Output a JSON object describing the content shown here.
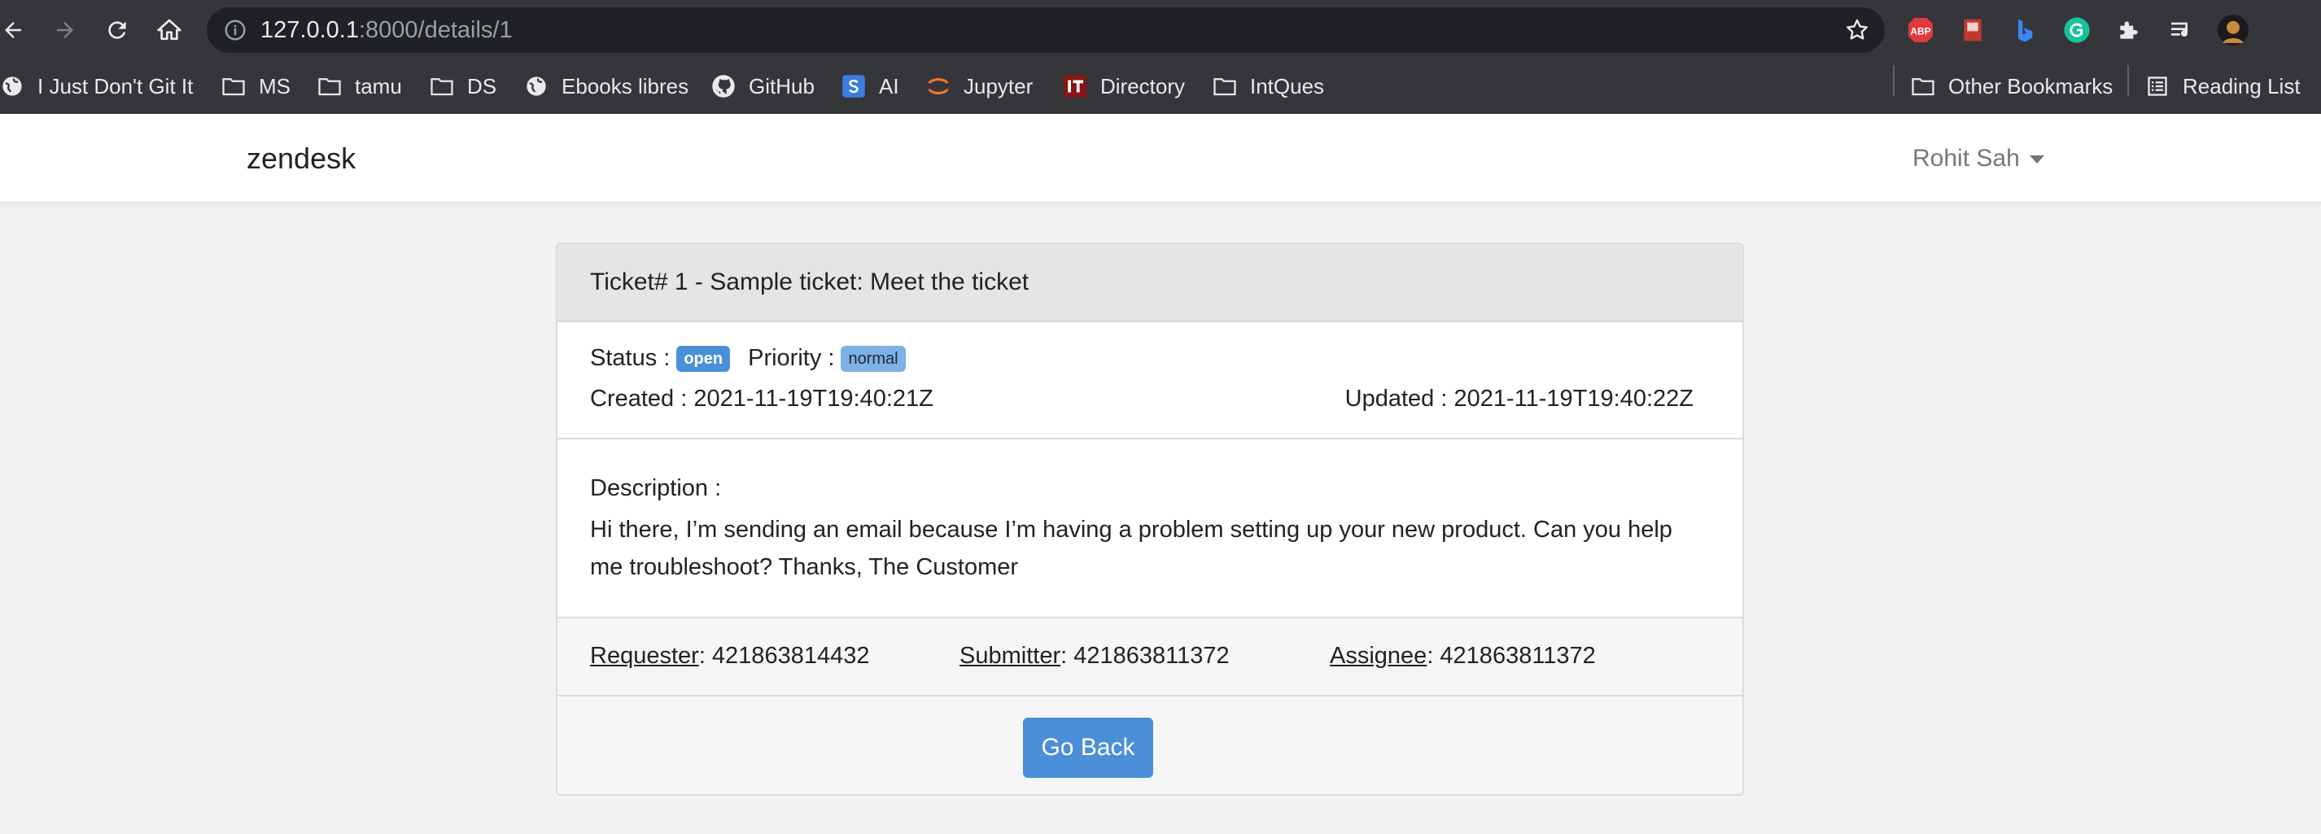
{
  "browser": {
    "url_host": "127.0.0.1",
    "url_path": ":8000/details/1",
    "bookmarks": [
      {
        "label": "I Just Don't Git It",
        "icon": "globe-icon"
      },
      {
        "label": "MS",
        "icon": "folder-icon"
      },
      {
        "label": "tamu",
        "icon": "folder-icon"
      },
      {
        "label": "DS",
        "icon": "folder-icon"
      },
      {
        "label": "Ebooks libres",
        "icon": "globe-icon"
      },
      {
        "label": "GitHub",
        "icon": "github-icon"
      },
      {
        "label": "AI",
        "icon": "s-badge-icon"
      },
      {
        "label": "Jupyter",
        "icon": "jupyter-icon"
      },
      {
        "label": "Directory",
        "icon": "it-badge-icon"
      },
      {
        "label": "IntQues",
        "icon": "folder-icon"
      }
    ],
    "other_bookmarks": "Other Bookmarks",
    "reading_list": "Reading List",
    "extensions": [
      "abp-icon",
      "pdf-icon",
      "bing-icon",
      "grammarly-icon",
      "puzzle-icon",
      "media-queue-icon",
      "profile-avatar"
    ],
    "abp_label": "ABP"
  },
  "navbar": {
    "brand": "zendesk",
    "user": "Rohit Sah"
  },
  "ticket": {
    "header": "Ticket# 1 - Sample ticket: Meet the ticket",
    "status_label": "Status :",
    "status": "open",
    "priority_label": "Priority :",
    "priority": "normal",
    "created": "Created : 2021-11-19T19:40:21Z",
    "updated": "Updated : 2021-11-19T19:40:22Z",
    "description_label": "Description :",
    "description": "Hi there, I’m sending an email because I’m having a problem setting up your new product. Can you help me troubleshoot? Thanks, The Customer",
    "requester_label": "Requester",
    "requester": ": 421863814432",
    "submitter_label": "Submitter",
    "submitter": ": 421863811372",
    "assignee_label": "Assignee",
    "assignee": ": 421863811372",
    "back_button": "Go Back"
  },
  "colors": {
    "chrome_bg": "#35363a",
    "omnibox_bg": "#202124",
    "status_badge": "#4a90d9",
    "priority_badge": "#7fb0e6",
    "button": "#4a8fd8",
    "card_header": "#e6e5e3"
  }
}
